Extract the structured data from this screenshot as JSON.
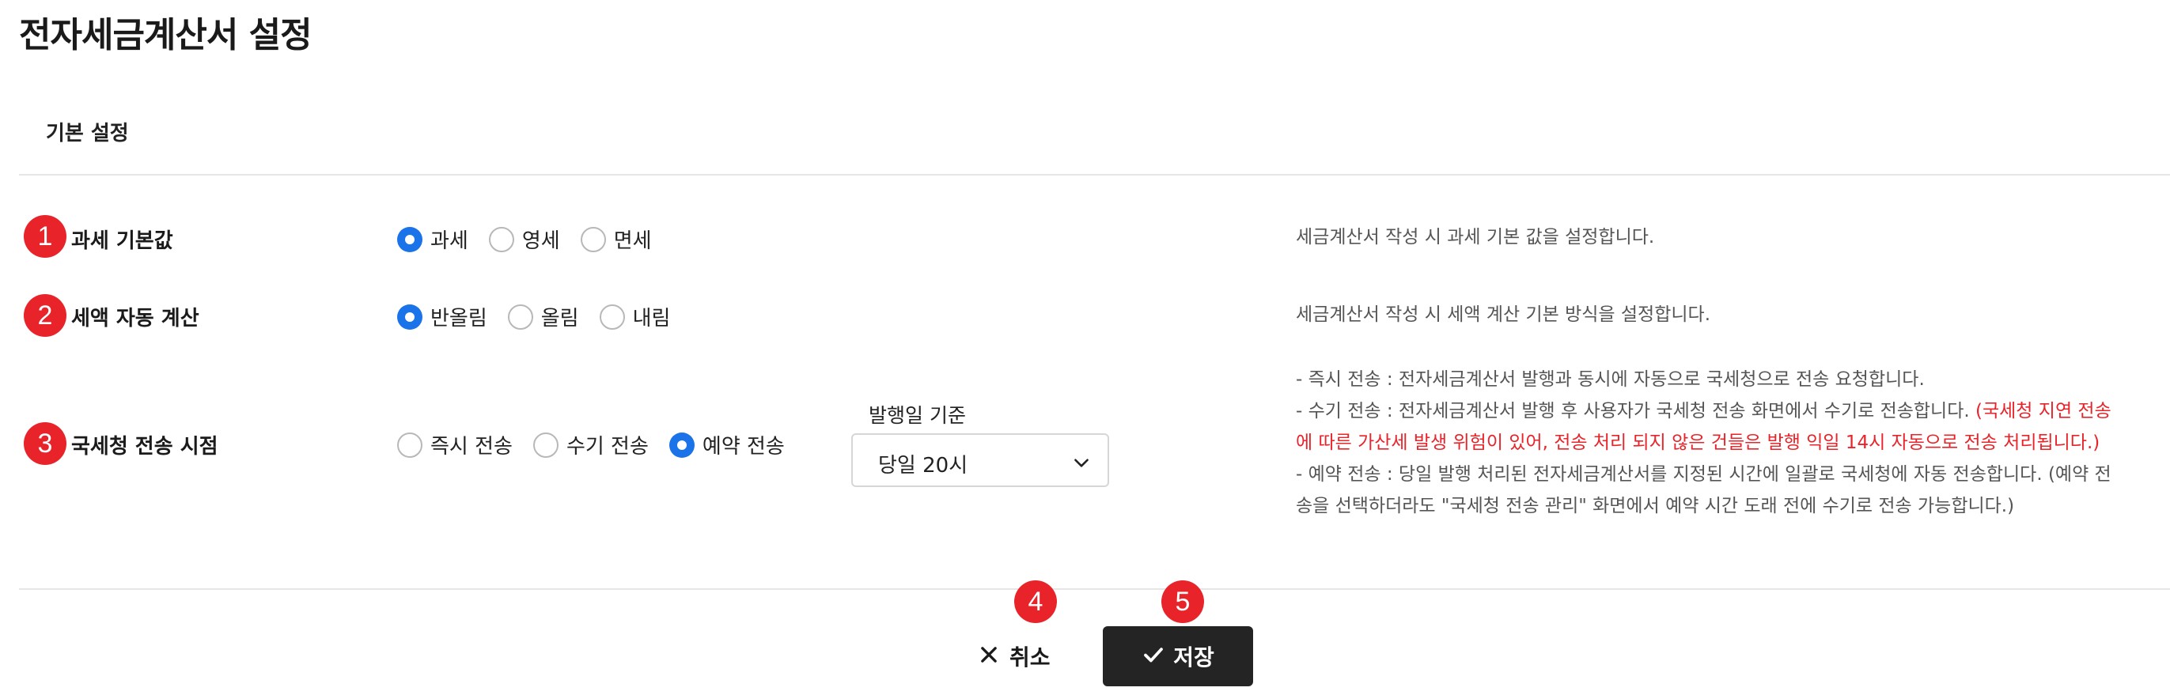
{
  "page": {
    "title": "전자세금계산서 설정"
  },
  "section": {
    "title": "기본 설정"
  },
  "markers": [
    "1",
    "2",
    "3",
    "4",
    "5"
  ],
  "rows": [
    {
      "label": "과세 기본값",
      "options": [
        {
          "label": "과세",
          "checked": true
        },
        {
          "label": "영세",
          "checked": false
        },
        {
          "label": "면세",
          "checked": false
        }
      ],
      "description": "세금계산서 작성 시 과세 기본 값을 설정합니다."
    },
    {
      "label": "세액 자동 계산",
      "options": [
        {
          "label": "반올림",
          "checked": true
        },
        {
          "label": "올림",
          "checked": false
        },
        {
          "label": "내림",
          "checked": false
        }
      ],
      "description": "세금계산서 작성 시 세액 계산 기본 방식을 설정합니다."
    },
    {
      "label": "국세청 전송 시점",
      "options": [
        {
          "label": "즉시 전송",
          "checked": false
        },
        {
          "label": "수기 전송",
          "checked": false
        },
        {
          "label": "예약 전송",
          "checked": true
        }
      ],
      "issue_date_label": "발행일 기준",
      "issue_date_value": "당일 20시",
      "description_lines": {
        "line1": "- 즉시 전송 : 전자세금계산서 발행과 동시에 자동으로 국세청으로 전송 요청합니다.",
        "line2a": "- 수기 전송 : 전자세금계산서 발행 후 사용자가 국세청 전송 화면에서 수기로 전송합니다. ",
        "line2b": "(국세청 지연 전송",
        "line3": "에 따른 가산세 발생 위험이 있어, 전송 처리 되지 않은 건들은 발행 익일 14시 자동으로 전송 처리됩니다.)",
        "line4": "- 예약 전송 : 당일 발행 처리된 전자세금계산서를 지정된 시간에 일괄로 국세청에 자동 전송합니다. (예약 전",
        "line5": "송을 선택하더라도 \"국세청 전송 관리\" 화면에서 예약 시간 도래 전에 수기로 전송 가능합니다.)"
      }
    }
  ],
  "buttons": {
    "cancel": "취소",
    "save": "저장"
  },
  "icons": {
    "close": "close-icon",
    "check": "check-icon",
    "chevron": "chevron-down-icon"
  },
  "colors": {
    "accent": "#1a73e8",
    "marker": "#e8242a",
    "warning": "#e8242a",
    "save_bg": "#242424"
  }
}
